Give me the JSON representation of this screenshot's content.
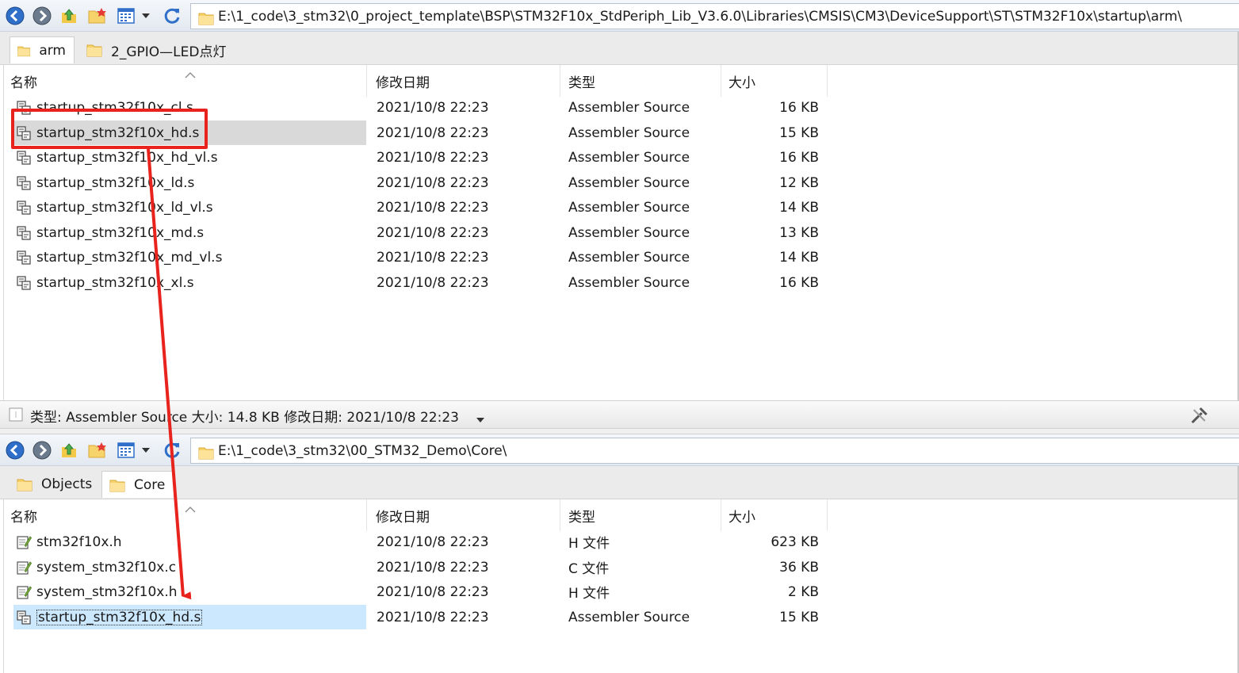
{
  "top": {
    "address": "E:\\1_code\\3_stm32\\0_project_template\\BSP\\STM32F10x_StdPeriph_Lib_V3.6.0\\Libraries\\CMSIS\\CM3\\DeviceSupport\\ST\\STM32F10x\\startup\\arm\\",
    "tabs": [
      {
        "label": "arm",
        "active": true
      },
      {
        "label": "2_GPIO—LED点灯",
        "active": false
      }
    ],
    "columns": {
      "name": "名称",
      "date": "修改日期",
      "type": "类型",
      "size": "大小"
    },
    "files": [
      {
        "name": "startup_stm32f10x_cl.s",
        "date": "2021/10/8 22:23",
        "type": "Assembler Source",
        "size": "16 KB"
      },
      {
        "name": "startup_stm32f10x_hd.s",
        "date": "2021/10/8 22:23",
        "type": "Assembler Source",
        "size": "15 KB"
      },
      {
        "name": "startup_stm32f10x_hd_vl.s",
        "date": "2021/10/8 22:23",
        "type": "Assembler Source",
        "size": "16 KB"
      },
      {
        "name": "startup_stm32f10x_ld.s",
        "date": "2021/10/8 22:23",
        "type": "Assembler Source",
        "size": "12 KB"
      },
      {
        "name": "startup_stm32f10x_ld_vl.s",
        "date": "2021/10/8 22:23",
        "type": "Assembler Source",
        "size": "14 KB"
      },
      {
        "name": "startup_stm32f10x_md.s",
        "date": "2021/10/8 22:23",
        "type": "Assembler Source",
        "size": "13 KB"
      },
      {
        "name": "startup_stm32f10x_md_vl.s",
        "date": "2021/10/8 22:23",
        "type": "Assembler Source",
        "size": "14 KB"
      },
      {
        "name": "startup_stm32f10x_xl.s",
        "date": "2021/10/8 22:23",
        "type": "Assembler Source",
        "size": "16 KB"
      }
    ],
    "status": "类型: Assembler Source 大小: 14.8 KB 修改日期: 2021/10/8 22:23"
  },
  "bottom": {
    "address": "E:\\1_code\\3_stm32\\00_STM32_Demo\\Core\\",
    "tabs": [
      {
        "label": "Objects",
        "active": false
      },
      {
        "label": "Core",
        "active": true
      }
    ],
    "columns": {
      "name": "名称",
      "date": "修改日期",
      "type": "类型",
      "size": "大小"
    },
    "files": [
      {
        "name": "stm32f10x.h",
        "date": "2021/10/8 22:23",
        "type": "H 文件",
        "size": "623 KB"
      },
      {
        "name": "system_stm32f10x.c",
        "date": "2021/10/8 22:23",
        "type": "C 文件",
        "size": "36 KB"
      },
      {
        "name": "system_stm32f10x.h",
        "date": "2021/10/8 22:23",
        "type": "H 文件",
        "size": "2 KB"
      },
      {
        "name": "startup_stm32f10x_hd.s",
        "date": "2021/10/8 22:23",
        "type": "Assembler Source",
        "size": "15 KB"
      }
    ]
  },
  "colors": {
    "highlight_red": "#e8231e",
    "selected_gray": "#d9d9d9",
    "selected_blue": "#cce8ff"
  }
}
